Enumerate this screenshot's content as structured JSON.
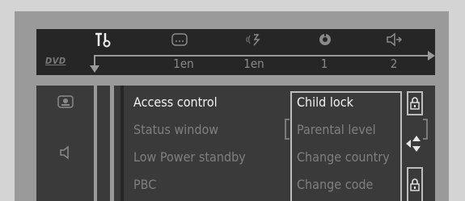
{
  "top_bar": {
    "icons": [
      "settings-icon",
      "subtitle-icon",
      "audio-icon",
      "angle-icon",
      "zoom-icon"
    ],
    "disc_label": "DVD",
    "values": [
      "1en",
      "1en",
      "1",
      "2"
    ]
  },
  "left_panel": {
    "icons": [
      "profile-icon",
      "speaker-icon"
    ]
  },
  "menu": {
    "items": [
      "Access control",
      "Status window",
      "Low Power standby",
      "PBC"
    ],
    "active_index": 0
  },
  "submenu": {
    "items": [
      "Child lock",
      "Parental level",
      "Change country",
      "Change code"
    ],
    "active_index": 0,
    "side_icons": [
      "lock-icon",
      "up-down-arrows-icon",
      "lock-icon"
    ]
  },
  "colors": {
    "background": "#d4d4d4",
    "osd_frame": "#9a9a9a",
    "panel": "#3a3a3a",
    "bar": "#262626",
    "text_active": "#f2f2f2",
    "text_inactive": "#7f7f7f",
    "outline": "#bdbdbd"
  }
}
